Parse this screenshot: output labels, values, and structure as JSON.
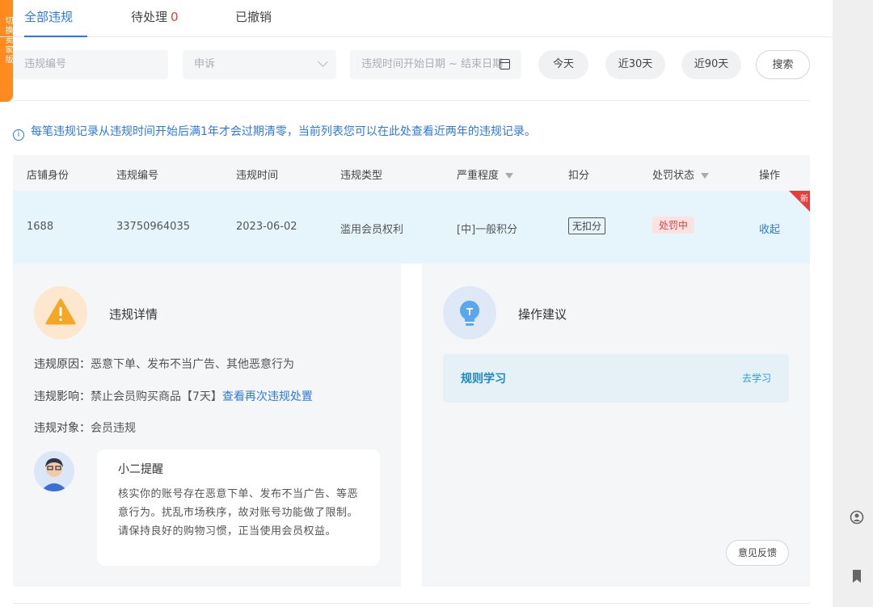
{
  "side_tab": {
    "label": "切换卖家版"
  },
  "tabs": [
    {
      "label": "全部违规",
      "count": ""
    },
    {
      "label": "待处理",
      "count": "0"
    },
    {
      "label": "已撤销",
      "count": ""
    }
  ],
  "filters": {
    "violation_id_placeholder": "违规编号",
    "appeal_select": "申诉",
    "date_range_placeholder": "违规时间开始日期 ~ 结束日期",
    "quick_today": "今天",
    "quick_30": "近30天",
    "quick_90": "近90天",
    "search_label": "搜索"
  },
  "notice": "每笔违规记录从违规时间开始后满1年才会过期清零，当前列表您可以在此处查看近两年的违规记录。",
  "table": {
    "headers": [
      "店铺身份",
      "违规编号",
      "违规时间",
      "违规类型",
      "严重程度",
      "扣分",
      "处罚状态",
      "操作"
    ],
    "row": {
      "shop_identity": "1688",
      "violation_id": "33750964035",
      "violation_time": "2023-06-02",
      "violation_type": "滥用会员权利",
      "severity": "[中]一般积分",
      "deduction": "无扣分",
      "penalty_status": "处罚中",
      "action": "收起",
      "new_badge": "新"
    }
  },
  "details": {
    "title": "违规详情",
    "reason_label": "违规原因：",
    "reason_value": "恶意下单、发布不当广告、其他恶意行为",
    "impact_label": "违规影响：",
    "impact_value": "禁止会员购买商品【7天】",
    "impact_link": "查看再次违规处置",
    "target_label": "违规对象：",
    "target_value": "会员违规",
    "reminder_title": "小二提醒",
    "reminder_body": "核实你的账号存在恶意下单、发布不当广告、等恶意行为。扰乱市场秩序，故对账号功能做了限制。请保持良好的购物习惯，正当使用会员权益。"
  },
  "suggestion": {
    "title": "操作建议",
    "item_title": "规则学习",
    "item_link": "去学习",
    "feedback_button": "意见反馈"
  },
  "colors": {
    "primary": "#2d78e6",
    "danger": "#e53e3e",
    "warning": "#f5a623",
    "side_tab": "#ff8a1f"
  },
  "icons": {
    "warning": "warning-triangle-icon",
    "bulb": "lightbulb-icon",
    "info": "info-icon",
    "calendar": "calendar-icon",
    "filter": "filter-icon"
  }
}
